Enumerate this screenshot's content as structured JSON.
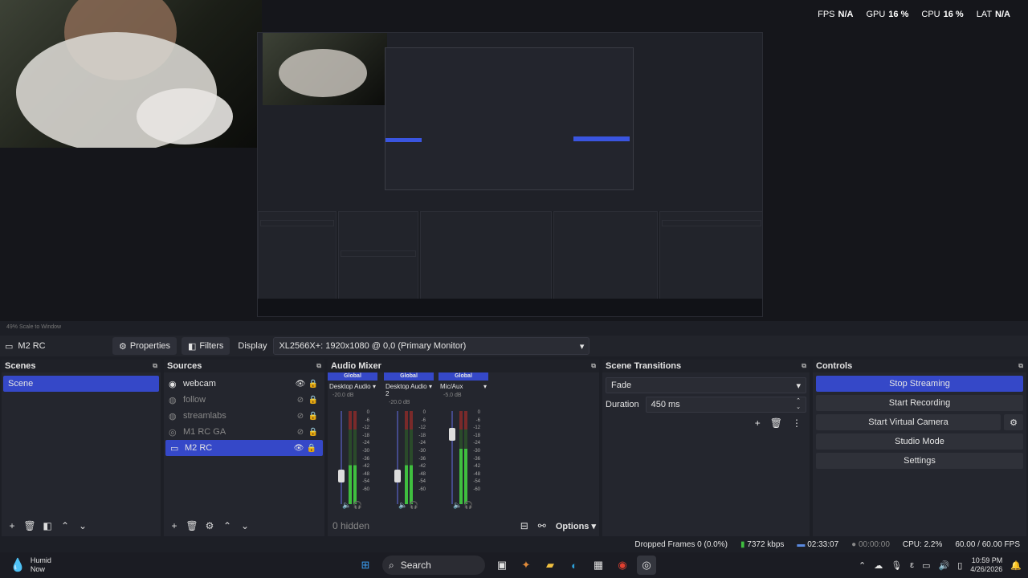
{
  "perf": {
    "fps_label": "FPS",
    "fps_value": "N/A",
    "gpu_label": "GPU",
    "gpu_value": "16 %",
    "cpu_label": "CPU",
    "cpu_value": "16 %",
    "lat_label": "LAT",
    "lat_value": "N/A"
  },
  "zoom": {
    "text": "49%   Scale to Window"
  },
  "toolbar": {
    "scene_name": "M2 RC",
    "properties_label": "Properties",
    "filters_label": "Filters",
    "display_label": "Display",
    "display_value": "XL2566X+: 1920x1080 @ 0,0 (Primary Monitor)"
  },
  "scenes": {
    "title": "Scenes",
    "items": [
      "Scene"
    ]
  },
  "sources": {
    "title": "Sources",
    "items": [
      "webcam",
      "follow",
      "streamlabs",
      "M1 RC GA",
      "M2 RC"
    ]
  },
  "mixer": {
    "title": "Audio Mixer",
    "channels": [
      {
        "global": "Global",
        "name": "Desktop Audio",
        "db": "-20.0 dB",
        "level": 0.3
      },
      {
        "global": "Global",
        "name": "Desktop Audio 2",
        "db": "-20.0 dB",
        "level": 0.3
      },
      {
        "global": "Global",
        "name": "Mic/Aux",
        "db": "-5.0 dB",
        "level": 0.75
      }
    ],
    "ticks": [
      "0",
      "-6",
      "-12",
      "-18",
      "-24",
      "-30",
      "-36",
      "-42",
      "-48",
      "-54",
      "-60"
    ],
    "hidden_label": "0 hidden",
    "options_label": "Options"
  },
  "transitions": {
    "title": "Scene Transitions",
    "type": "Fade",
    "duration_label": "Duration",
    "duration_value": "450 ms"
  },
  "controls": {
    "title": "Controls",
    "stop_streaming": "Stop Streaming",
    "start_recording": "Start Recording",
    "start_virtual_camera": "Start Virtual Camera",
    "studio_mode": "Studio Mode",
    "settings": "Settings"
  },
  "status": {
    "dropped": "Dropped Frames 0 (0.0%)",
    "bitrate": "7372 kbps",
    "stream_time": "02:33:07",
    "rec_time": "00:00:00",
    "cpu": "CPU: 2.2%",
    "fps": "60.00 / 60.00 FPS"
  },
  "taskbar": {
    "weather_title": "Humid",
    "weather_sub": "Now",
    "search_label": "Search",
    "time": "10:59 PM",
    "date": "4/26/2026"
  },
  "colors": {
    "accent": "#3548c8",
    "meter_green": "#3fbf3f",
    "meter_red": "#c0392b"
  }
}
